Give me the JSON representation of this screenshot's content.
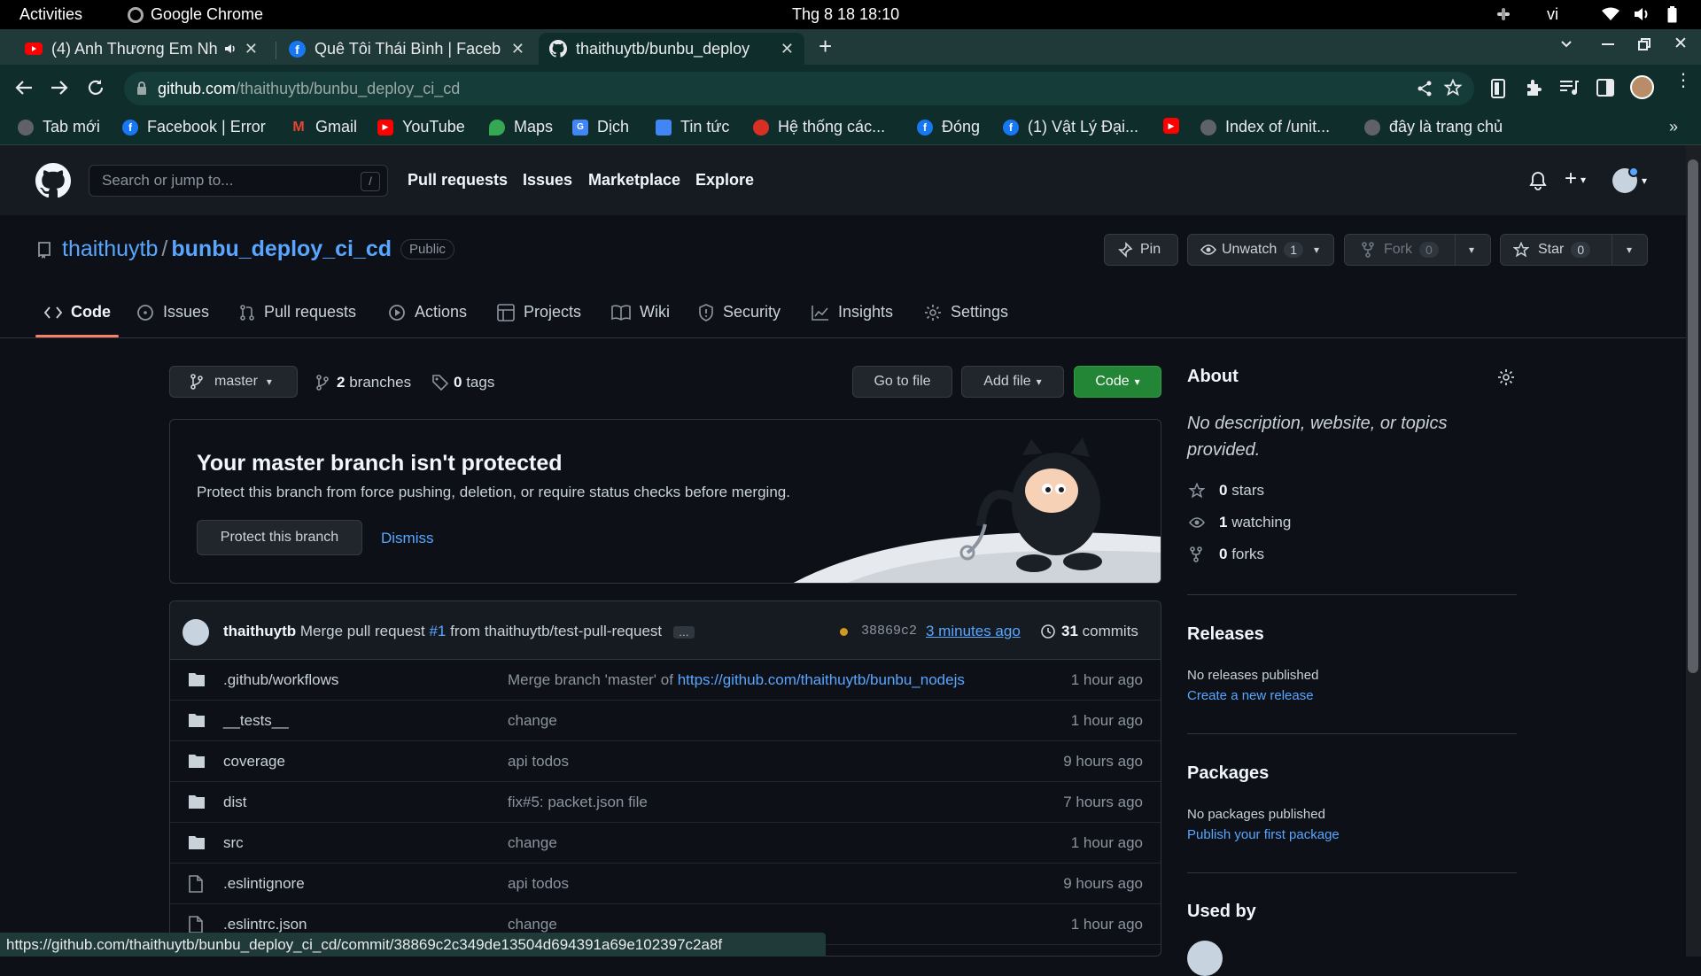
{
  "os_bar": {
    "activities": "Activities",
    "app": "Google Chrome",
    "datetime": "Thg 8 18  18:10",
    "lang": "vi"
  },
  "tabs": [
    {
      "title": "(4) Anh Thương Em Nh",
      "icon": "youtube-icon"
    },
    {
      "title": "Quê Tôi Thái Bình | Faceb",
      "icon": "facebook-icon"
    },
    {
      "title": "thaithuytb/bunbu_deploy",
      "icon": "github-icon"
    }
  ],
  "address": {
    "host": "github.com",
    "path": "/thaithuytb/bunbu_deploy_ci_cd"
  },
  "bookmarks": [
    {
      "label": "Tab mới",
      "color": "#5f6368"
    },
    {
      "label": "Facebook | Error",
      "color": "#1877f2"
    },
    {
      "label": "Gmail",
      "color": "#ea4335"
    },
    {
      "label": "YouTube",
      "color": "#ff0000"
    },
    {
      "label": "Maps",
      "color": "#34a853"
    },
    {
      "label": "Dịch",
      "color": "#4285f4"
    },
    {
      "label": "Tin tức",
      "color": "#4285f4"
    },
    {
      "label": "Hệ thống các...",
      "color": "#d93025"
    },
    {
      "label": "Đóng",
      "color": "#1877f2"
    },
    {
      "label": "(1) Vật Lý Đại...",
      "color": "#1877f2"
    },
    {
      "label": "",
      "color": "#ff0000"
    },
    {
      "label": "Index of /unit...",
      "color": "#5f6368"
    },
    {
      "label": "đây là trang chủ",
      "color": "#5f6368"
    }
  ],
  "gh_nav": {
    "search_placeholder": "Search or jump to...",
    "search_key": "/",
    "links": [
      "Pull requests",
      "Issues",
      "Marketplace",
      "Explore"
    ]
  },
  "repo": {
    "owner": "thaithuytb",
    "sep": "/",
    "name": "bunbu_deploy_ci_cd",
    "visibility": "Public",
    "pin": "Pin",
    "watch": "Unwatch",
    "watch_count": "1",
    "fork": "Fork",
    "fork_count": "0",
    "star": "Star",
    "star_count": "0"
  },
  "repo_tabs": [
    "Code",
    "Issues",
    "Pull requests",
    "Actions",
    "Projects",
    "Wiki",
    "Security",
    "Insights",
    "Settings"
  ],
  "branch_bar": {
    "branch": "master",
    "branches_count": "2",
    "branches_label": "branches",
    "tags_count": "0",
    "tags_label": "tags",
    "goto": "Go to file",
    "add": "Add file",
    "code": "Code"
  },
  "protect": {
    "title": "Your master branch isn't protected",
    "desc": "Protect this branch from force pushing, deletion, or require status checks before merging.",
    "button": "Protect this branch",
    "dismiss": "Dismiss"
  },
  "commit": {
    "author": "thaithuytb",
    "msg_pre": "Merge pull request",
    "pr": "#1",
    "msg_post": "from thaithuytb/test-pull-request",
    "ellipsis": "…",
    "sha": "38869c2",
    "time": "3 minutes ago",
    "count": "31",
    "count_label": "commits"
  },
  "files": [
    {
      "type": "dir",
      "name": ".github/workflows",
      "msg": "Merge branch 'master' of ",
      "link": "https://github.com/thaithuytb/bunbu_nodejs",
      "time": "1 hour ago"
    },
    {
      "type": "dir",
      "name": "__tests__",
      "msg": "change",
      "link": "",
      "time": "1 hour ago"
    },
    {
      "type": "dir",
      "name": "coverage",
      "msg": "api todos",
      "link": "",
      "time": "9 hours ago"
    },
    {
      "type": "dir",
      "name": "dist",
      "msg": "fix#5: packet.json file",
      "link": "",
      "time": "7 hours ago"
    },
    {
      "type": "dir",
      "name": "src",
      "msg": "change",
      "link": "",
      "time": "1 hour ago"
    },
    {
      "type": "file",
      "name": ".eslintignore",
      "msg": "api todos",
      "link": "",
      "time": "9 hours ago"
    },
    {
      "type": "file",
      "name": ".eslintrc.json",
      "msg": "change",
      "link": "",
      "time": "1 hour ago"
    }
  ],
  "about": {
    "title": "About",
    "desc": "No description, website, or topics provided.",
    "stars_n": "0",
    "stars": "stars",
    "watching_n": "1",
    "watching": "watching",
    "forks_n": "0",
    "forks": "forks"
  },
  "releases": {
    "title": "Releases",
    "none": "No releases published",
    "link": "Create a new release"
  },
  "packages": {
    "title": "Packages",
    "none": "No packages published",
    "link": "Publish your first package"
  },
  "used_by": {
    "title": "Used by"
  },
  "status_url": "https://github.com/thaithuytb/bunbu_deploy_ci_cd/commit/38869c2c349de13504d694391a69e102397c2a8f",
  "colors": {
    "accent": "#58a6ff",
    "green_btn": "#238636",
    "bg": "#0d1117",
    "header": "#161b22"
  }
}
